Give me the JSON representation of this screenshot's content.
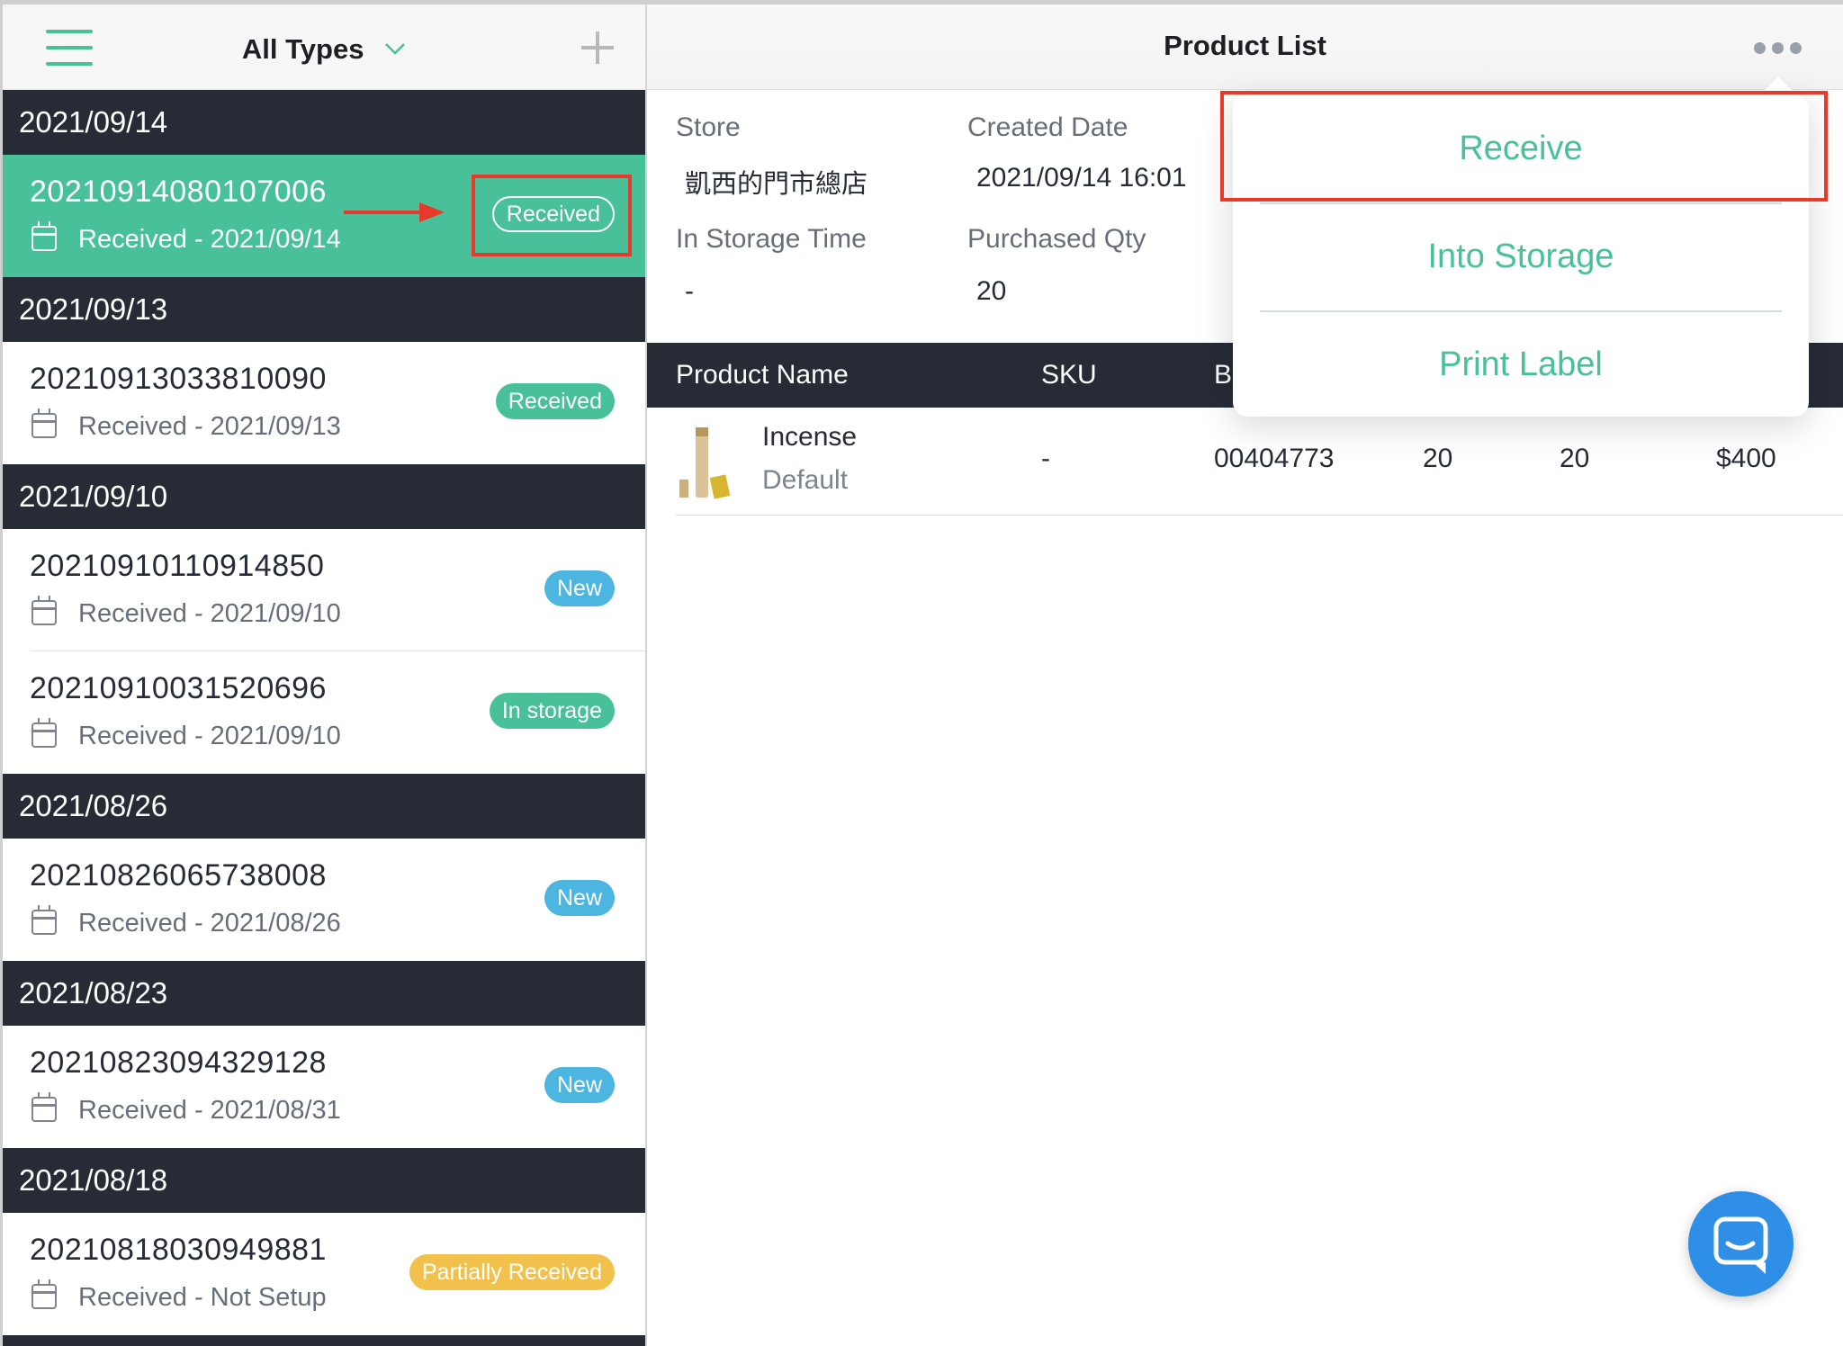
{
  "left_header": {
    "filter_label": "All Types"
  },
  "groups": [
    {
      "date": "2021/09/14",
      "orders": [
        {
          "number": "20210914080107006",
          "subtitle": "Received - 2021/09/14",
          "badge": "Received",
          "badge_style": "outline",
          "selected": true
        }
      ]
    },
    {
      "date": "2021/09/13",
      "orders": [
        {
          "number": "20210913033810090",
          "subtitle": "Received - 2021/09/13",
          "badge": "Received",
          "badge_style": "green"
        }
      ]
    },
    {
      "date": "2021/09/10",
      "orders": [
        {
          "number": "20210910110914850",
          "subtitle": "Received - 2021/09/10",
          "badge": "New",
          "badge_style": "blue"
        },
        {
          "number": "20210910031520696",
          "subtitle": "Received - 2021/09/10",
          "badge": "In storage",
          "badge_style": "green"
        }
      ]
    },
    {
      "date": "2021/08/26",
      "orders": [
        {
          "number": "20210826065738008",
          "subtitle": "Received - 2021/08/26",
          "badge": "New",
          "badge_style": "blue"
        }
      ]
    },
    {
      "date": "2021/08/23",
      "orders": [
        {
          "number": "20210823094329128",
          "subtitle": "Received - 2021/08/31",
          "badge": "New",
          "badge_style": "blue"
        }
      ]
    },
    {
      "date": "2021/08/18",
      "orders": [
        {
          "number": "20210818030949881",
          "subtitle": "Received - Not Setup",
          "badge": "Partially Received",
          "badge_style": "yellow"
        }
      ]
    }
  ],
  "detail": {
    "title": "Product List",
    "store_label": "Store",
    "store_value": "凱西的門市總店",
    "created_label": "Created Date",
    "created_value": "2021/09/14 16:01",
    "storage_time_label": "In Storage Time",
    "storage_time_value": "-",
    "purchased_label": "Purchased Qty",
    "purchased_value": "20"
  },
  "table": {
    "col_product": "Product Name",
    "col_sku": "SKU",
    "col_barcode_partial": "B",
    "row": {
      "name": "Incense",
      "variant": "Default",
      "sku": "-",
      "barcode": "00404773",
      "qty1": "20",
      "qty2": "20",
      "price": "$400"
    }
  },
  "menu": {
    "items": [
      "Receive",
      "Into Storage",
      "Print Label"
    ]
  },
  "colors": {
    "accent": "#48c19a",
    "dark_header": "#262b36",
    "badge_blue": "#4cb6e0",
    "badge_yellow": "#f1c14b",
    "annotation_red": "#e73a2b",
    "chat_blue": "#2f8ee6"
  },
  "icons": [
    "hamburger-menu-icon",
    "chevron-down-icon",
    "plus-icon",
    "more-dots-icon",
    "calendar-icon",
    "chat-icon"
  ]
}
